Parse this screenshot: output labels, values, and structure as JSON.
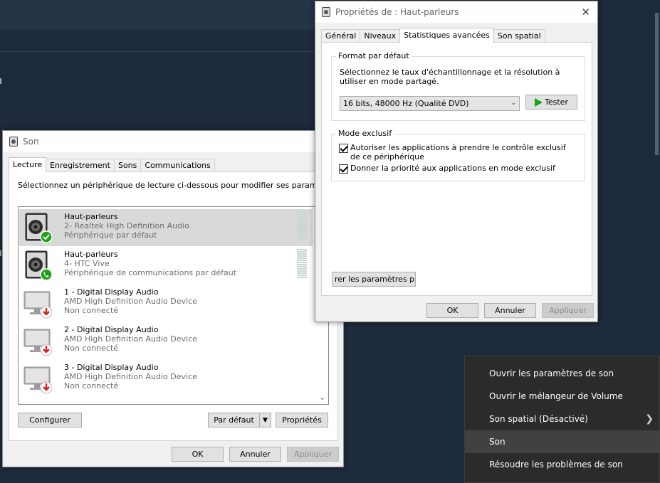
{
  "son_window": {
    "title": "Son",
    "tabs": [
      "Lecture",
      "Enregistrement",
      "Sons",
      "Communications"
    ],
    "instruction": "Sélectionnez un périphérique de lecture ci-dessous pour modifier ses paramètres",
    "devices": [
      {
        "name": "Haut-parleurs",
        "line2": "2- Realtek High Definition Audio",
        "line3": "Périphérique par défaut",
        "icon": "speaker-icon",
        "badge": "default-check-badge",
        "selected": true
      },
      {
        "name": "Haut-parleurs",
        "line2": "4- HTC Vive",
        "line3": "Périphérique de communications par défaut",
        "icon": "speaker-icon",
        "badge": "phone-badge",
        "selected": false
      },
      {
        "name": "1 - Digital Display Audio",
        "line2": "AMD High Definition Audio Device",
        "line3": "Non connecté",
        "icon": "monitor-icon",
        "badge": "disconnected-badge",
        "selected": false
      },
      {
        "name": "2 - Digital Display Audio",
        "line2": "AMD High Definition Audio Device",
        "line3": "Non connecté",
        "icon": "monitor-icon",
        "badge": "disconnected-badge",
        "selected": false
      },
      {
        "name": "3 - Digital Display Audio",
        "line2": "AMD High Definition Audio Device",
        "line3": "Non connecté",
        "icon": "monitor-icon",
        "badge": "disconnected-badge",
        "selected": false
      }
    ],
    "configure_label": "Configurer",
    "default_label": "Par défaut",
    "properties_label": "Propriétés",
    "ok_label": "OK",
    "cancel_label": "Annuler",
    "apply_label": "Appliquer"
  },
  "props_window": {
    "title": "Propriétés de : Haut-parleurs",
    "tabs": [
      "Général",
      "Niveaux",
      "Statistiques avancées",
      "Son spatial"
    ],
    "format_group_label": "Format par défaut",
    "format_description": "Sélectionnez le taux d'échantillonnage et la résolution à utiliser en mode partagé.",
    "format_value": "16 bits, 48000 Hz (Qualité DVD)",
    "test_label": "Tester",
    "exclusive_group_label": "Mode exclusif",
    "exclusive_allow_label": "Autoriser les applications à prendre le contrôle exclusif de ce périphérique",
    "exclusive_allow_checked": true,
    "exclusive_priority_label": "Donner la priorité aux applications en mode exclusif",
    "exclusive_priority_checked": true,
    "restore_label": "rer les paramètres par",
    "ok_label": "OK",
    "cancel_label": "Annuler",
    "apply_label": "Appliquer"
  },
  "context_menu": {
    "items": [
      {
        "label": "Ouvrir les paramètres de son",
        "submenu": false,
        "hover": false
      },
      {
        "label": "Ouvrir le mélangeur de Volume",
        "submenu": false,
        "hover": false
      },
      {
        "label": "Son spatial (Désactivé)",
        "submenu": true,
        "hover": false
      },
      {
        "label": "Son",
        "submenu": false,
        "hover": true
      },
      {
        "label": "Résoudre les problèmes de son",
        "submenu": false,
        "hover": false
      }
    ]
  },
  "colors": {
    "desktop": "#1e2b3c",
    "context_menu_bg": "#2b2b2b",
    "menu_hover": "#414141",
    "selected_row": "#d9d9d9",
    "check_green": "#1aa31a",
    "disconnect_red": "#d32020"
  }
}
